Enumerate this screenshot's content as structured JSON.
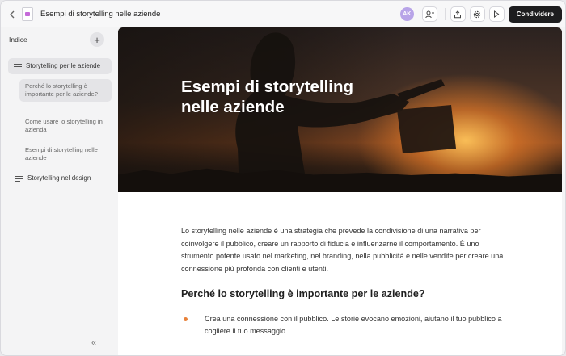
{
  "topbar": {
    "title": "Esempi di storytelling nelle aziende",
    "avatar_initials": "AK",
    "share_label": "Condividere"
  },
  "sidebar": {
    "header": "Indice",
    "items": [
      {
        "label": "Storytelling per le aziende",
        "active": true
      },
      {
        "label": "Perché lo storytelling è importante per le aziende?",
        "sub": true,
        "active": true
      },
      {
        "label": "Come usare lo storytelling in azienda",
        "sub": true
      },
      {
        "label": "Esempi di storytelling nelle aziende",
        "sub": true
      },
      {
        "label": "Storytelling nel design"
      }
    ]
  },
  "main": {
    "hero_title": "Esempi di storytelling nelle aziende",
    "intro": "Lo storytelling nelle aziende è una strategia che prevede la condivisione di una narrativa per coinvolgere il pubblico, creare un rapporto di fiducia e influenzarne il comportamento. È uno strumento potente usato nel marketing, nel branding, nella pubblicità e nelle vendite per creare una connessione più profonda con clienti e utenti.",
    "section_heading": "Perché lo storytelling è importante per le aziende?",
    "bullets": [
      "Crea una connessione con il pubblico. Le storie evocano emozioni, aiutano il tuo pubblico a cogliere il tuo messaggio."
    ]
  },
  "colors": {
    "accent": "#e8813a",
    "share_button": "#1d1d1f",
    "avatar": "#b8a4e8"
  }
}
